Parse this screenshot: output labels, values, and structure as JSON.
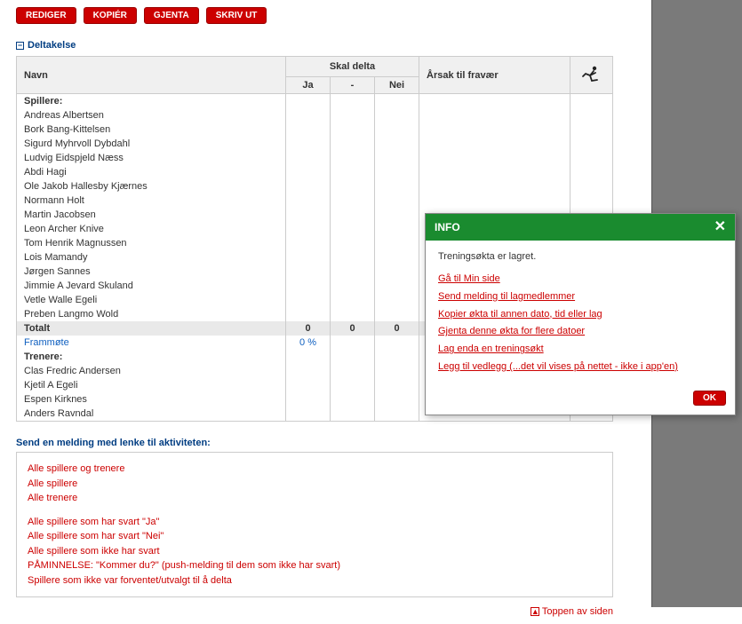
{
  "toolbar": {
    "rediger": "REDIGER",
    "kopier": "KOPIÉR",
    "gjenta": "GJENTA",
    "skrivut": "SKRIV UT"
  },
  "section": {
    "title": "Deltakelse"
  },
  "table": {
    "headers": {
      "navn": "Navn",
      "skal_delta": "Skal delta",
      "ja": "Ja",
      "dash": "-",
      "nei": "Nei",
      "arsak": "Årsak til fravær"
    },
    "spillere_label": "Spillere:",
    "spillere": [
      "Andreas Albertsen",
      "Bork Bang-Kittelsen",
      "Sigurd Myhrvoll Dybdahl",
      "Ludvig Eidspjeld Næss",
      "Abdi Hagi",
      "Ole Jakob Hallesby Kjærnes",
      "Normann Holt",
      "Martin Jacobsen",
      "Leon Archer Knive",
      "Tom Henrik Magnussen",
      "Lois Mamandy",
      "Jørgen Sannes",
      "Jimmie A Jevard Skuland",
      "Vetle Walle Egeli",
      "Preben Langmo Wold"
    ],
    "totalt_label": "Totalt",
    "totalt": {
      "ja": "0",
      "dash": "0",
      "nei": "0"
    },
    "frammote_label": "Frammøte",
    "frammote_pct": "0 %",
    "trenere_label": "Trenere:",
    "trenere": [
      "Clas Fredric Andersen",
      "Kjetil A Egeli",
      "Espen Kirknes",
      "Anders Ravndal"
    ]
  },
  "send": {
    "title": "Send en melding med lenke til aktiviteten:",
    "links1": [
      "Alle spillere og trenere",
      "Alle spillere",
      "Alle trenere"
    ],
    "links2": [
      "Alle spillere som har svart \"Ja\"",
      "Alle spillere som har svart \"Nei\"",
      "Alle spillere som ikke har svart",
      "PÅMINNELSE: \"Kommer du?\" (push-melding til dem som ikke har svart)",
      "Spillere som ikke var forventet/utvalgt til å delta"
    ]
  },
  "footer": {
    "toppen": "Toppen av siden"
  },
  "info": {
    "title": "INFO",
    "message": "Treningsøkta er lagret.",
    "links": [
      "Gå til Min side",
      "Send melding til lagmedlemmer",
      "Kopier økta til annen dato, tid eller lag",
      "Gjenta denne økta for flere datoer",
      "Lag enda en treningsøkt",
      "Legg til vedlegg (...det vil vises på nettet - ikke i app'en)"
    ],
    "ok": "OK"
  }
}
